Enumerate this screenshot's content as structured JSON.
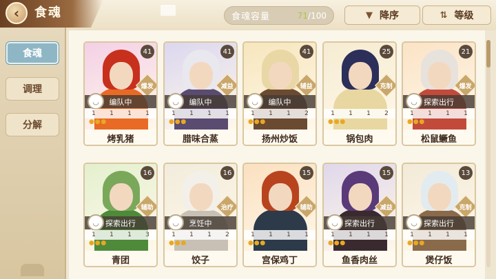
{
  "header": {
    "title": "食魂",
    "capacity_label": "食魂容量",
    "capacity_current": "71",
    "capacity_total": "/100",
    "sort_order_label": "降序",
    "sort_field_label": "等级"
  },
  "sidebar": {
    "items": [
      {
        "label": "食魂"
      },
      {
        "label": "调理"
      },
      {
        "label": "分解"
      }
    ]
  },
  "cards": [
    {
      "name": "烤乳猪",
      "level": "41",
      "status": "编队中",
      "role": "爆发",
      "stats": [
        "1",
        "1",
        "1",
        "1"
      ]
    },
    {
      "name": "腊味合蒸",
      "level": "41",
      "status": "编队中",
      "role": "减益",
      "stats": [
        "1",
        "1",
        "1",
        "1"
      ]
    },
    {
      "name": "扬州炒饭",
      "level": "41",
      "status": "编队中",
      "role": "辅益",
      "stats": [
        "1",
        "1",
        "1",
        "2"
      ]
    },
    {
      "name": "锅包肉",
      "level": "25",
      "status": "",
      "role": "克制",
      "stats": [
        "1",
        "1",
        "1",
        "2"
      ]
    },
    {
      "name": "松鼠鳜鱼",
      "level": "21",
      "status": "探索出行",
      "role": "爆发",
      "stats": [
        "1",
        "1",
        "1",
        "1"
      ]
    },
    {
      "name": "青团",
      "level": "16",
      "status": "探索出行",
      "role": "辅助",
      "stats": [
        "1",
        "1",
        "1",
        "3"
      ]
    },
    {
      "name": "饺子",
      "level": "16",
      "status": "烹饪中",
      "role": "治疗",
      "stats": [
        "1",
        "1",
        "1",
        "2"
      ]
    },
    {
      "name": "宫保鸡丁",
      "level": "15",
      "status": "",
      "role": "辅助",
      "stats": [
        "1",
        "1",
        "1",
        "1"
      ]
    },
    {
      "name": "鱼香肉丝",
      "level": "15",
      "status": "探索出行",
      "role": "减益",
      "stats": [
        "1",
        "1",
        "1",
        "1"
      ]
    },
    {
      "name": "煲仔饭",
      "level": "13",
      "status": "探索出行",
      "role": "克制",
      "stats": [
        "1",
        "1",
        "1",
        "1"
      ]
    }
  ],
  "icons": {
    "back": "chevron-left-icon",
    "sort_order": "sort-arrows-icon",
    "sort_field": "sort-filter-icon",
    "status": "bowl-icon"
  },
  "colors": {
    "accent_blue": "#8fb6c4",
    "title_brown": "#6a4022",
    "capacity_current": "#a6c84a",
    "star": "#e8a822"
  }
}
